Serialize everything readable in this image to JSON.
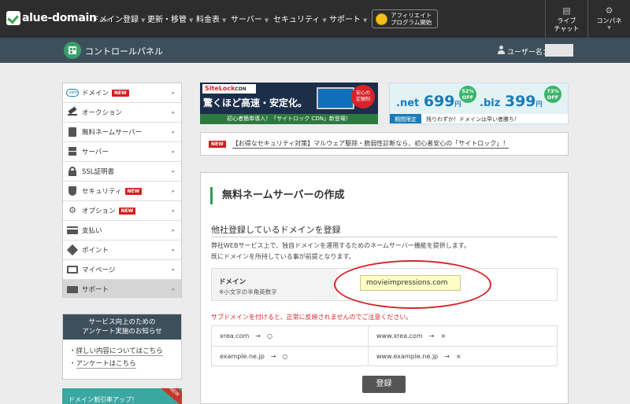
{
  "topnav": {
    "logo_text": "alue-domain",
    "logo_sub": ".com",
    "items": [
      {
        "label": "ドメイン登録"
      },
      {
        "label": "更新・移管"
      },
      {
        "label": "料金表"
      },
      {
        "label": "サーバー"
      },
      {
        "label": "セキュリティ"
      },
      {
        "label": "サポート"
      }
    ],
    "affiliate_line1": "アフィリエイト",
    "affiliate_line2": "プログラム開始",
    "chat_line1": "ライブ",
    "chat_line2": "チャット",
    "konpane_label": "コンパネ"
  },
  "cpbar": {
    "title": "コントロールパネル",
    "user_label": "ユーザー名："
  },
  "sidebar": {
    "items": [
      {
        "label": "ドメイン",
        "new": true
      },
      {
        "label": "オークション",
        "new": false
      },
      {
        "label": "無料ネームサーバー",
        "new": false
      },
      {
        "label": "サーバー",
        "new": false
      },
      {
        "label": "SSL証明書",
        "new": false
      },
      {
        "label": "セキュリティ",
        "new": true
      },
      {
        "label": "オプション",
        "new": true
      },
      {
        "label": "支払い",
        "new": false
      },
      {
        "label": "ポイント",
        "new": false
      },
      {
        "label": "マイページ",
        "new": false
      },
      {
        "label": "サポート",
        "new": false
      }
    ],
    "new_badge": "NEW",
    "arrow": "▸",
    "notice_line1": "サービス向上のための",
    "notice_line2": "アンケート実施のお知らせ",
    "notice_links": [
      "詳しい内容についてはこちら",
      "アンケートはこちら"
    ],
    "promo_text": "ドメイン割引率アップ！",
    "promo_corner": "NEW"
  },
  "banner1": {
    "logo": "SiteLock",
    "logo_sub": "CDN",
    "headline": "驚くほど高速・安定化。",
    "badge_line1": "安心の",
    "badge_line2": "定額制",
    "bottom": "初心者簡単導入！「サイトロック CDN」新登場！"
  },
  "banner2": {
    "net_tld": ".net",
    "net_price": "699",
    "net_off_line1": "52%",
    "net_off_line2": "OFF",
    "biz_tld": ".biz",
    "biz_price": "399",
    "biz_off_line1": "73%",
    "biz_off_line2": "OFF",
    "yen": "円",
    "tag": "期間限定",
    "bottom_text": "残りわずか！ドメインは早い者勝ち！"
  },
  "news": {
    "badge": "NEW",
    "text": "【お得なセキュリティ対策】マルウェア駆除・脆弱性診断なら、初心者安心の「サイトロック」！"
  },
  "main": {
    "title": "無料ネームサーバーの作成",
    "subtitle": "他社登録しているドメインを登録",
    "desc1": "弊社WEBサービス上で、独自ドメインを運用するためのネームサーバー機能を提供します。",
    "desc2": "既にドメインを所持している事が前提となります。",
    "domain_label": "ドメイン",
    "domain_note": "※小文字の半角英数字",
    "domain_value": "movieimpressions.com",
    "warning": "サブドメインを付けると、正常に反映されませんのでご注意ください。",
    "examples": [
      {
        "left": "xrea.com　→　○",
        "right": "www.xrea.com　→　×"
      },
      {
        "left": "example.ne.jp　→　○",
        "right": "www.example.ne.jp　→　×"
      }
    ],
    "register_label": "登録"
  }
}
